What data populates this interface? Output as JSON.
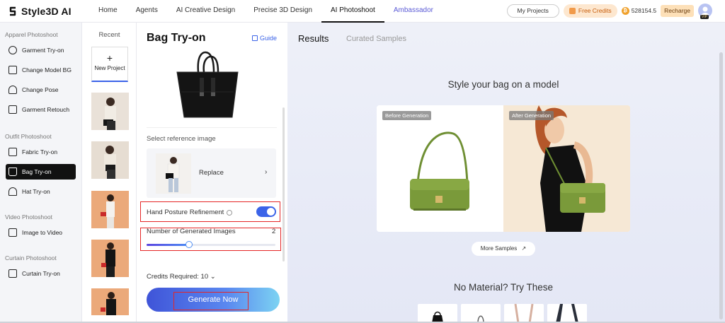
{
  "brand": {
    "name": "Style3D AI"
  },
  "nav": {
    "items": [
      "Home",
      "Agents",
      "AI Creative Design",
      "Precise 3D Design",
      "AI Photoshoot",
      "Ambassador"
    ],
    "active": "AI Photoshoot"
  },
  "header": {
    "my_projects": "My Projects",
    "free_credits": "Free Credits",
    "coin_symbol": "₿",
    "balance": "528154.5",
    "recharge": "Recharge",
    "vip": "VIP"
  },
  "sidebar": {
    "sections": [
      {
        "title": "Apparel Photoshoot",
        "items": [
          "Garment Try-on",
          "Change Model BG",
          "Change Pose",
          "Garment Retouch"
        ]
      },
      {
        "title": "Outfit Photoshoot",
        "items": [
          "Fabric Try-on",
          "Bag Try-on",
          "Hat Try-on"
        ]
      },
      {
        "title": "Video Photoshoot",
        "items": [
          "Image to Video"
        ]
      },
      {
        "title": "Curtain Photoshoot",
        "items": [
          "Curtain Try-on"
        ]
      }
    ],
    "active_item": "Bag Try-on"
  },
  "recent": {
    "title": "Recent",
    "new_project": "New Project"
  },
  "panel": {
    "title": "Bag Try-on",
    "guide": "Guide",
    "select_reference": "Select reference image",
    "replace": "Replace",
    "replace_arrow": "›",
    "hand_posture": "Hand Posture Refinement",
    "hand_posture_enabled": true,
    "num_images_label": "Number of Generated Images",
    "num_images_value": "2",
    "slider_fraction": 0.33,
    "credits_required": "Credits Required: 10",
    "generate": "Generate Now"
  },
  "main": {
    "tabs": [
      "Results",
      "Curated Samples"
    ],
    "active_tab": "Results",
    "heading": "Style your bag on a model",
    "before_tag": "Before Generation",
    "after_tag": "After Generation",
    "more_samples": "More Samples",
    "no_material": "No Material? Try These"
  },
  "colors": {
    "accent": "#3b63e8",
    "highlight_border": "#e52626",
    "bag_green": "#7a9a3a",
    "active_sidebar_bg": "#111111"
  }
}
